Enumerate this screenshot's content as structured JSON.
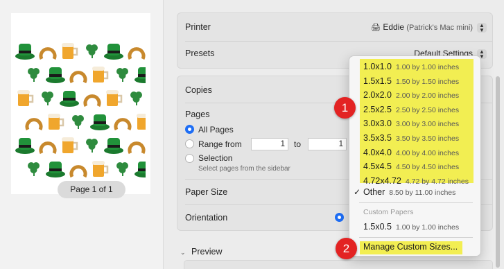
{
  "thumbnail": {
    "page_label": "Page 1 of 1"
  },
  "printer": {
    "label": "Printer",
    "value": "Eddie",
    "sub": "(Patrick's Mac mini)"
  },
  "presets": {
    "label": "Presets",
    "value": "Default Settings"
  },
  "copies": {
    "label": "Copies"
  },
  "pages": {
    "label": "Pages",
    "all_pages": "All Pages",
    "range_from": "Range from",
    "range_to": "to",
    "range_from_value": "1",
    "range_to_value": "1",
    "selection": "Selection",
    "selection_hint": "Select pages from the sidebar"
  },
  "paper_size": {
    "label": "Paper Size"
  },
  "orientation": {
    "label": "Orientation"
  },
  "preview": {
    "label": "Preview"
  },
  "menu": {
    "items": [
      {
        "name": "1.0x1.0",
        "size": "1.00 by 1.00 inches"
      },
      {
        "name": "1.5x1.5",
        "size": "1.50 by 1.50 inches"
      },
      {
        "name": "2.0x2.0",
        "size": "2.00 by 2.00 inches"
      },
      {
        "name": "2.5x2.5",
        "size": "2.50 by 2.50 inches"
      },
      {
        "name": "3.0x3.0",
        "size": "3.00 by 3.00 inches"
      },
      {
        "name": "3.5x3.5",
        "size": "3.50 by 3.50 inches"
      },
      {
        "name": "4.0x4.0",
        "size": "4.00 by 4.00 inches"
      },
      {
        "name": "4.5x4.5",
        "size": "4.50 by 4.50 inches"
      },
      {
        "name": "4.72x4.72",
        "size": "4.72 by 4.72 inches"
      }
    ],
    "other": {
      "name": "Other",
      "size": "8.50 by 11.00 inches",
      "checked": "✓"
    },
    "custom_heading": "Custom Papers",
    "custom": {
      "name": "1.5x0.5",
      "size": "1.00 by 1.00 inches"
    },
    "manage": "Manage Custom Sizes..."
  },
  "annotations": {
    "badge1": "1",
    "badge2": "2"
  },
  "colors": {
    "highlight": "#f2ee52",
    "accent": "#1e6ef5",
    "badge": "#e32323"
  }
}
